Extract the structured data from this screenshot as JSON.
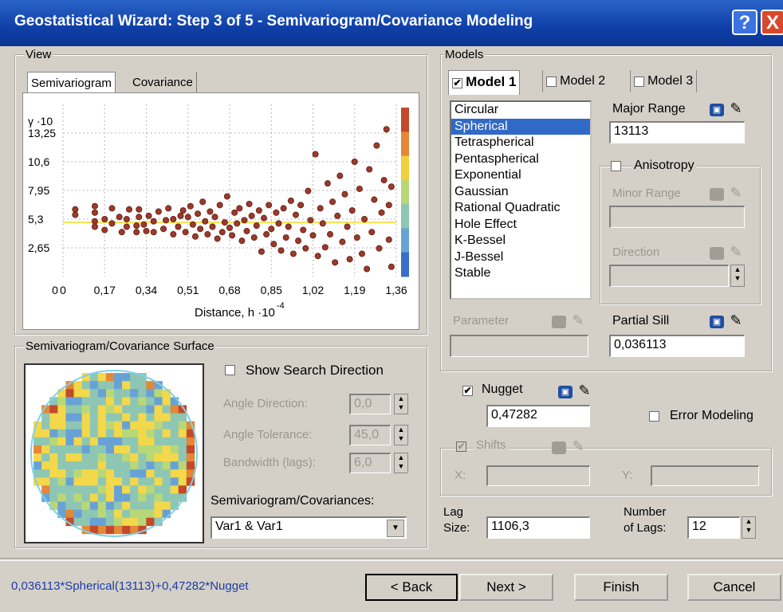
{
  "window": {
    "title": "Geostatistical Wizard: Step 3 of 5 - Semivariogram/Covariance Modeling"
  },
  "titlebar_buttons": {
    "help": "?",
    "close": "X"
  },
  "view": {
    "group_label": "View",
    "tabs": [
      {
        "label": "Semivariogram"
      },
      {
        "label": "Covariance"
      }
    ]
  },
  "chart_data": {
    "type": "scatter",
    "ylabel": "γ ·10",
    "xlabel": "Distance, h ·10",
    "xlabel_exp": "-4",
    "xticks": [
      "0",
      "0,17",
      "0,34",
      "0,51",
      "0,68",
      "0,85",
      "1,02",
      "1,19",
      "1,36"
    ],
    "yticks": [
      "0",
      "2,65",
      "5,3",
      "7,95",
      "10,6",
      "13,25"
    ],
    "xlim": [
      0,
      1.36
    ],
    "ylim": [
      0,
      15.9
    ],
    "model_line": {
      "color": "#f5e65a",
      "x": [
        0,
        1.36
      ],
      "y": [
        5.0,
        5.0
      ]
    },
    "points_color": "#9c3a2a",
    "colorbar": [
      "#c24a2a",
      "#e28838",
      "#f2cf3c",
      "#b8d878",
      "#8ec6b4",
      "#68a2d4",
      "#3a6ec8"
    ],
    "points": [
      [
        0.05,
        5.7
      ],
      [
        0.05,
        6.2
      ],
      [
        0.13,
        6.5
      ],
      [
        0.13,
        5.9
      ],
      [
        0.13,
        5.1
      ],
      [
        0.13,
        4.6
      ],
      [
        0.17,
        4.3
      ],
      [
        0.17,
        5.3
      ],
      [
        0.2,
        6.3
      ],
      [
        0.2,
        4.9
      ],
      [
        0.23,
        5.5
      ],
      [
        0.24,
        4.1
      ],
      [
        0.26,
        4.6
      ],
      [
        0.26,
        5.3
      ],
      [
        0.27,
        6.2
      ],
      [
        0.3,
        4.7
      ],
      [
        0.3,
        4.1
      ],
      [
        0.31,
        5.5
      ],
      [
        0.31,
        6.2
      ],
      [
        0.33,
        4.8
      ],
      [
        0.34,
        4.2
      ],
      [
        0.35,
        5.6
      ],
      [
        0.37,
        5.1
      ],
      [
        0.37,
        4.1
      ],
      [
        0.39,
        6.0
      ],
      [
        0.41,
        4.4
      ],
      [
        0.42,
        5.2
      ],
      [
        0.43,
        6.3
      ],
      [
        0.45,
        3.9
      ],
      [
        0.45,
        5.3
      ],
      [
        0.47,
        4.6
      ],
      [
        0.48,
        5.6
      ],
      [
        0.49,
        6.1
      ],
      [
        0.5,
        4.1
      ],
      [
        0.51,
        5.5
      ],
      [
        0.52,
        6.5
      ],
      [
        0.53,
        4.8
      ],
      [
        0.54,
        3.7
      ],
      [
        0.55,
        5.8
      ],
      [
        0.56,
        4.4
      ],
      [
        0.57,
        6.9
      ],
      [
        0.58,
        5.1
      ],
      [
        0.59,
        3.9
      ],
      [
        0.6,
        6.0
      ],
      [
        0.61,
        4.6
      ],
      [
        0.62,
        5.5
      ],
      [
        0.63,
        3.5
      ],
      [
        0.64,
        6.6
      ],
      [
        0.65,
        4.1
      ],
      [
        0.66,
        5.0
      ],
      [
        0.67,
        7.4
      ],
      [
        0.68,
        4.5
      ],
      [
        0.69,
        3.8
      ],
      [
        0.7,
        5.9
      ],
      [
        0.71,
        4.9
      ],
      [
        0.72,
        6.3
      ],
      [
        0.73,
        3.3
      ],
      [
        0.74,
        5.2
      ],
      [
        0.75,
        4.2
      ],
      [
        0.76,
        6.7
      ],
      [
        0.77,
        5.6
      ],
      [
        0.78,
        3.6
      ],
      [
        0.79,
        4.7
      ],
      [
        0.8,
        6.1
      ],
      [
        0.81,
        2.3
      ],
      [
        0.82,
        5.4
      ],
      [
        0.83,
        3.9
      ],
      [
        0.84,
        6.6
      ],
      [
        0.85,
        4.4
      ],
      [
        0.86,
        3.0
      ],
      [
        0.87,
        5.9
      ],
      [
        0.88,
        4.9
      ],
      [
        0.89,
        2.4
      ],
      [
        0.9,
        6.3
      ],
      [
        0.91,
        3.6
      ],
      [
        0.92,
        4.6
      ],
      [
        0.93,
        7.0
      ],
      [
        0.94,
        2.1
      ],
      [
        0.95,
        5.7
      ],
      [
        0.96,
        3.3
      ],
      [
        0.97,
        6.6
      ],
      [
        0.98,
        4.3
      ],
      [
        0.99,
        2.6
      ],
      [
        1.0,
        7.9
      ],
      [
        1.01,
        5.2
      ],
      [
        1.02,
        3.8
      ],
      [
        1.03,
        11.3
      ],
      [
        1.04,
        1.9
      ],
      [
        1.05,
        6.3
      ],
      [
        1.06,
        4.9
      ],
      [
        1.07,
        2.7
      ],
      [
        1.08,
        8.6
      ],
      [
        1.09,
        3.9
      ],
      [
        1.1,
        6.9
      ],
      [
        1.11,
        1.3
      ],
      [
        1.12,
        5.6
      ],
      [
        1.13,
        9.3
      ],
      [
        1.14,
        3.2
      ],
      [
        1.15,
        7.6
      ],
      [
        1.16,
        4.6
      ],
      [
        1.17,
        1.6
      ],
      [
        1.18,
        6.1
      ],
      [
        1.19,
        10.6
      ],
      [
        1.2,
        3.6
      ],
      [
        1.21,
        8.1
      ],
      [
        1.22,
        2.1
      ],
      [
        1.23,
        5.3
      ],
      [
        1.24,
        0.7
      ],
      [
        1.25,
        9.9
      ],
      [
        1.26,
        4.1
      ],
      [
        1.27,
        7.1
      ],
      [
        1.28,
        12.1
      ],
      [
        1.29,
        2.6
      ],
      [
        1.3,
        5.9
      ],
      [
        1.31,
        8.9
      ],
      [
        1.32,
        13.6
      ],
      [
        1.33,
        3.4
      ],
      [
        1.33,
        6.6
      ],
      [
        1.34,
        0.9
      ],
      [
        1.34,
        8.3
      ]
    ]
  },
  "surface": {
    "group_label": "Semivariogram/Covariance Surface",
    "show_search_direction": "Show Search Direction",
    "angle_direction": {
      "label": "Angle Direction:",
      "value": "0,0"
    },
    "angle_tolerance": {
      "label": "Angle Tolerance:",
      "value": "45,0"
    },
    "bandwidth": {
      "label": "Bandwidth (lags):",
      "value": "6,0"
    },
    "semivariogram_covariances": {
      "label": "Semivariogram/Covariances:",
      "value": "Var1 & Var1"
    }
  },
  "models": {
    "group_label": "Models",
    "tabs": [
      {
        "label": "Model 1",
        "checked": true
      },
      {
        "label": "Model 2",
        "checked": false
      },
      {
        "label": "Model 3",
        "checked": false
      }
    ],
    "list": [
      "Circular",
      "Spherical",
      "Tetraspherical",
      "Pentaspherical",
      "Exponential",
      "Gaussian",
      "Rational Quadratic",
      "Hole Effect",
      "K-Bessel",
      "J-Bessel",
      "Stable"
    ],
    "selected": "Spherical",
    "major_range": {
      "label": "Major Range",
      "value": "13113"
    },
    "anisotropy": "Anisotropy",
    "minor_range": {
      "label": "Minor Range",
      "value": ""
    },
    "direction": {
      "label": "Direction",
      "value": ""
    },
    "parameter": {
      "label": "Parameter",
      "value": ""
    },
    "partial_sill": {
      "label": "Partial Sill",
      "value": "0,036113"
    }
  },
  "nugget": {
    "label": "Nugget",
    "value": "0,47282"
  },
  "error_modeling": "Error Modeling",
  "shifts": {
    "label": "Shifts",
    "x_label": "X:",
    "y_label": "Y:"
  },
  "lag": {
    "size_label_1": "Lag",
    "size_label_2": "Size:",
    "size_value": "1106,3",
    "number_label_1": "Number",
    "number_label_2": "of Lags:",
    "number_value": "12"
  },
  "status_formula": "0,036113*Spherical(13113)+0,47282*Nugget",
  "buttons": {
    "back": "< Back",
    "next": "Next >",
    "finish": "Finish",
    "cancel": "Cancel"
  },
  "icons": {
    "check": "✔",
    "pencil": "✎",
    "save": "▣",
    "spin_up": "▲",
    "spin_down": "▼",
    "dropdown": "▼"
  }
}
